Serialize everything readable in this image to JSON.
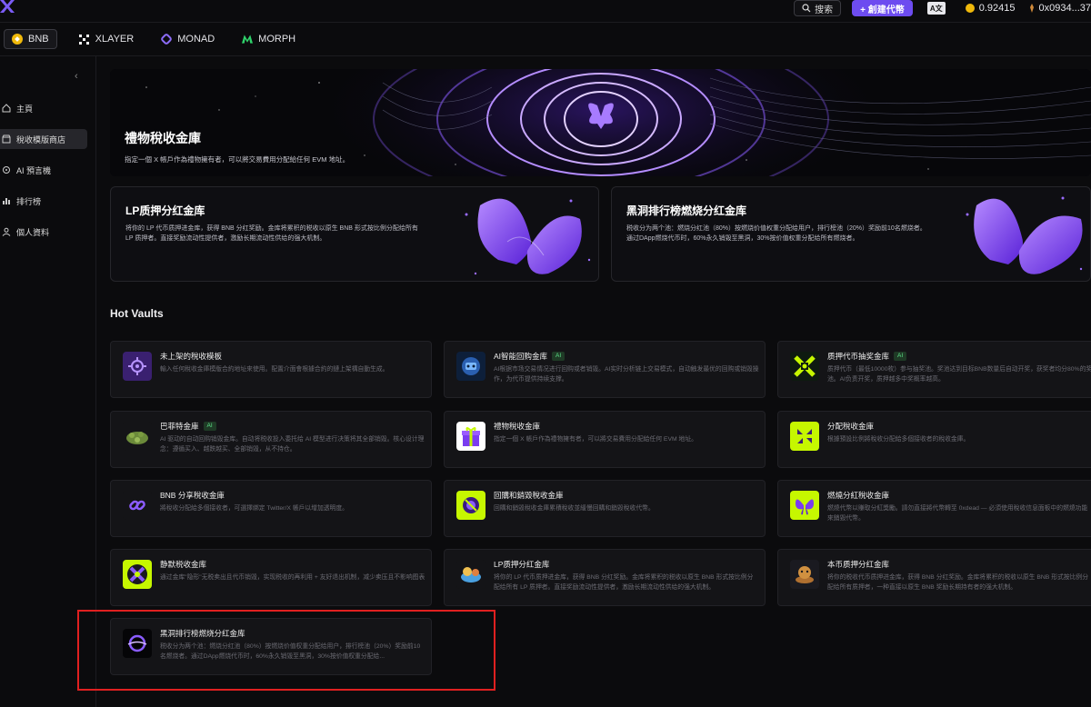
{
  "header": {
    "search_label": "搜索",
    "create_label": "+ 創建代幣",
    "lang_label": "A文",
    "price": "0.92415",
    "wallet": "0x0934...37"
  },
  "chains": [
    {
      "label": "BNB",
      "color": "#f0b90b",
      "icon": "bnb-icon"
    },
    {
      "label": "XLAYER",
      "color": "#ffffff",
      "icon": "xlayer-icon"
    },
    {
      "label": "MONAD",
      "color": "#8c6cf7",
      "icon": "monad-icon"
    },
    {
      "label": "MORPH",
      "color": "#2fd16a",
      "icon": "morph-icon"
    }
  ],
  "sidebar": {
    "items": [
      {
        "label": "主頁",
        "icon": "home-icon"
      },
      {
        "label": "稅收模版商店",
        "icon": "store-icon"
      },
      {
        "label": "AI 預言機",
        "icon": "ai-icon"
      },
      {
        "label": "排行榜",
        "icon": "ranking-icon"
      },
      {
        "label": "個人資料",
        "icon": "profile-icon"
      }
    ]
  },
  "hero": {
    "title": "禮物稅收金庫",
    "desc": "指定一個 X 帳戶作為禮物擁有者，可以將交易費用分配給任何 EVM 地址。"
  },
  "banners": [
    {
      "title": "LP质押分红金库",
      "desc": "将你的 LP 代币质押进金库，获得 BNB 分红奖励。金库将累积的税收以原生 BNB 形式按比例分配给所有 LP 质押者。直接奖励流动性提供者，激励长期流动性供给的强大机制。"
    },
    {
      "title": "黑洞排行榜燃烧分红金库",
      "desc": "税收分为两个池：燃烧分红池（80%）按燃烧价值权重分配给用户，排行榜池（20%）奖励前10名燃烧者。通过DApp燃烧代币时，60%永久销毁至黑洞，30%按价值权重分配给所有燃烧者。"
    }
  ],
  "hot_title": "Hot Vaults",
  "ai_badge": "AI",
  "vaults": [
    {
      "title": "未上架的稅收模板",
      "ai": false,
      "icon": "gear-icon",
      "desc": "輸入任何稅收金庫模版合約地址來使用。配置介面會根據合約的鏈上架構自動生成。"
    },
    {
      "title": "AI智能回购金库",
      "ai": true,
      "icon": "robot-icon",
      "desc": "AI根据市场交易情况进行回购或者销毁。AI实时分析链上交易模式，自动触发最优的回购或销毁操作，为代币提供持续支撑。"
    },
    {
      "title": "质押代币抽奖金库",
      "ai": true,
      "icon": "lottery-icon",
      "desc": "质押代币（最低10000枚）参与抽奖池。奖池达到目标BNB数量后自动开奖，获奖者均分80%的奖池。AI负责开奖，质押越多中奖概率越高。"
    },
    {
      "title": "巴菲特金庫",
      "ai": true,
      "icon": "buffett-icon",
      "desc": "AI 驱动的自动回购销毁金库。自动将税收投入委托给 AI 模型进行决策将其全部销毁。核心设计理念：遵循买入、越跌越买、全部销毁，从不持仓。"
    },
    {
      "title": "禮物稅收金庫",
      "ai": false,
      "icon": "gift-icon",
      "desc": "指定一個 X 帳戶作為禮物擁有者，可以將交易費用分配給任何 EVM 地址。"
    },
    {
      "title": "分配稅收金庫",
      "ai": false,
      "icon": "distribute-icon",
      "desc": "根據預設比例將稅收分配給多個接收者的稅收金庫。"
    },
    {
      "title": "BNB 分享稅收金庫",
      "ai": false,
      "icon": "link-icon",
      "desc": "將稅收分配給多個接收者，可選擇綁定 Twitter/X 帳戶以增加透明度。"
    },
    {
      "title": "回購和銷毀稅收金庫",
      "ai": false,
      "icon": "buyback-icon",
      "desc": "回購和銷毀稅收金庫累積稅收並緩慢回購和銷毀稅收代幣。"
    },
    {
      "title": "燃燒分紅稅收金庫",
      "ai": false,
      "icon": "butterfly-icon",
      "desc": "燃燒代幣以賺取分紅獎勵。請勿直接將代幣轉至 0xdead — 必須使用稅收信息面板中的燃燒功能來銷毀代幣。"
    },
    {
      "title": "静默税收金库",
      "ai": false,
      "icon": "silent-icon",
      "desc": "通过金库\"隐形\"无税卖出且代币销毁，实现税收的再利用 + 友好退出机制，减少卖压且不影响图表"
    },
    {
      "title": "LP质押分红金库",
      "ai": false,
      "icon": "lp-icon",
      "desc": "将你的 LP 代币质押进金库，获得 BNB 分红奖励。金库将累积的税收以原生 BNB 形式按比例分配给所有 LP 质押者。直接奖励流动性提供者，激励长期流动性供给的强大机制。"
    },
    {
      "title": "本币质押分红金库",
      "ai": false,
      "icon": "stake-icon",
      "desc": "将你的税收代币质押进金库，获得 BNB 分红奖励。金库将累积的税收以原生 BNB 形式按比例分配给所有质押者，一种直接以原生 BNB 奖励长期持有者的强大机制。"
    },
    {
      "title": "黑洞排行榜燃烧分红金库",
      "ai": false,
      "icon": "blackhole-icon",
      "desc": "税收分为两个池：燃烧分红池（80%）按燃烧价值权重分配给用户，排行榜池（20%）奖励前10名燃烧者。通过DApp燃烧代币时，60%永久销毁至黑洞，30%按价值权重分配给..."
    }
  ]
}
